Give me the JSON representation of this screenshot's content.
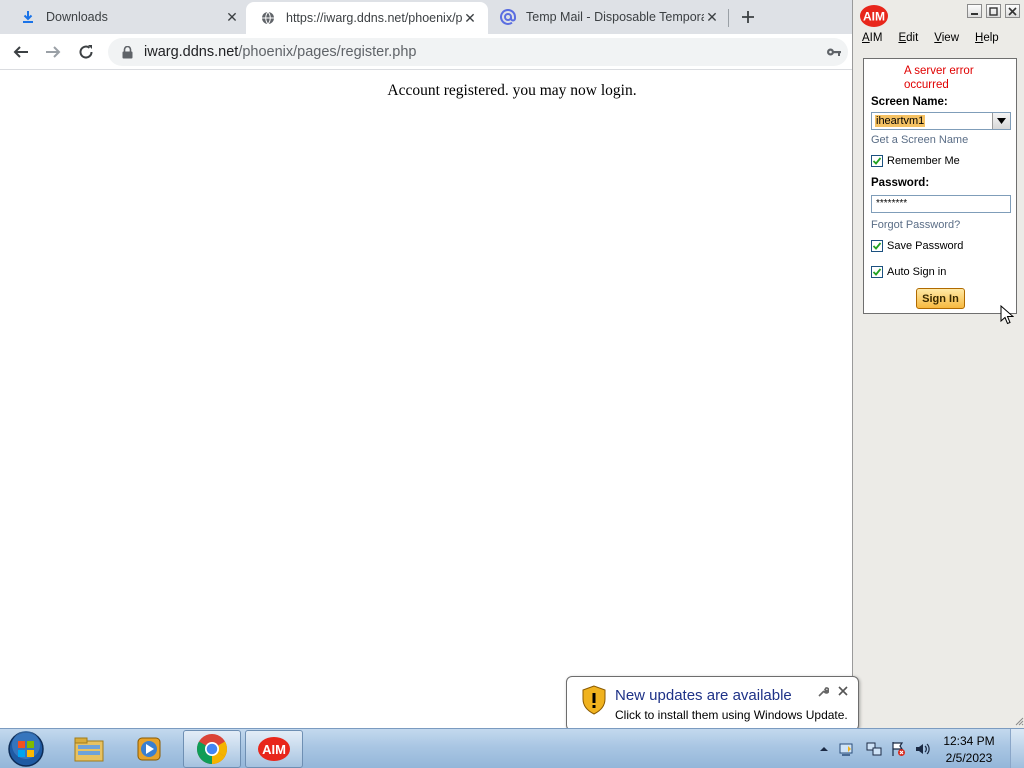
{
  "browser": {
    "tabs": [
      {
        "title": "Downloads",
        "icon": "download-icon",
        "active": false
      },
      {
        "title": "https://iwarg.ddns.net/phoenix/p",
        "icon": "globe-icon",
        "active": true
      },
      {
        "title": "Temp Mail - Disposable Tempora",
        "icon": "at-sign-icon",
        "active": false
      }
    ],
    "url_host": "iwarg.ddns.net",
    "url_path": "/phoenix/pages/register.php",
    "page_message": "Account registered. you may now login."
  },
  "aim": {
    "menu": [
      "AIM",
      "Edit",
      "View",
      "Help"
    ],
    "error": "A server error occurred",
    "screen_name_label": "Screen Name:",
    "screen_name_value": "iheartvm1",
    "get_screen_name": "Get a Screen Name",
    "remember_me": "Remember Me",
    "password_label": "Password:",
    "password_value": "********",
    "forgot_password": "Forgot Password?",
    "save_password": "Save Password",
    "auto_sign_in": "Auto Sign in",
    "sign_in": "Sign In",
    "colors": {
      "error": "#e00000",
      "button": "#f7b940"
    }
  },
  "notification": {
    "title": "New updates are available",
    "text": "Click to install them using Windows Update."
  },
  "taskbar": {
    "pinned": [
      "windows-explorer-icon",
      "media-player-icon",
      "chrome-icon",
      "aim-icon"
    ],
    "clock_time": "12:34 PM",
    "clock_date": "2/5/2023"
  }
}
